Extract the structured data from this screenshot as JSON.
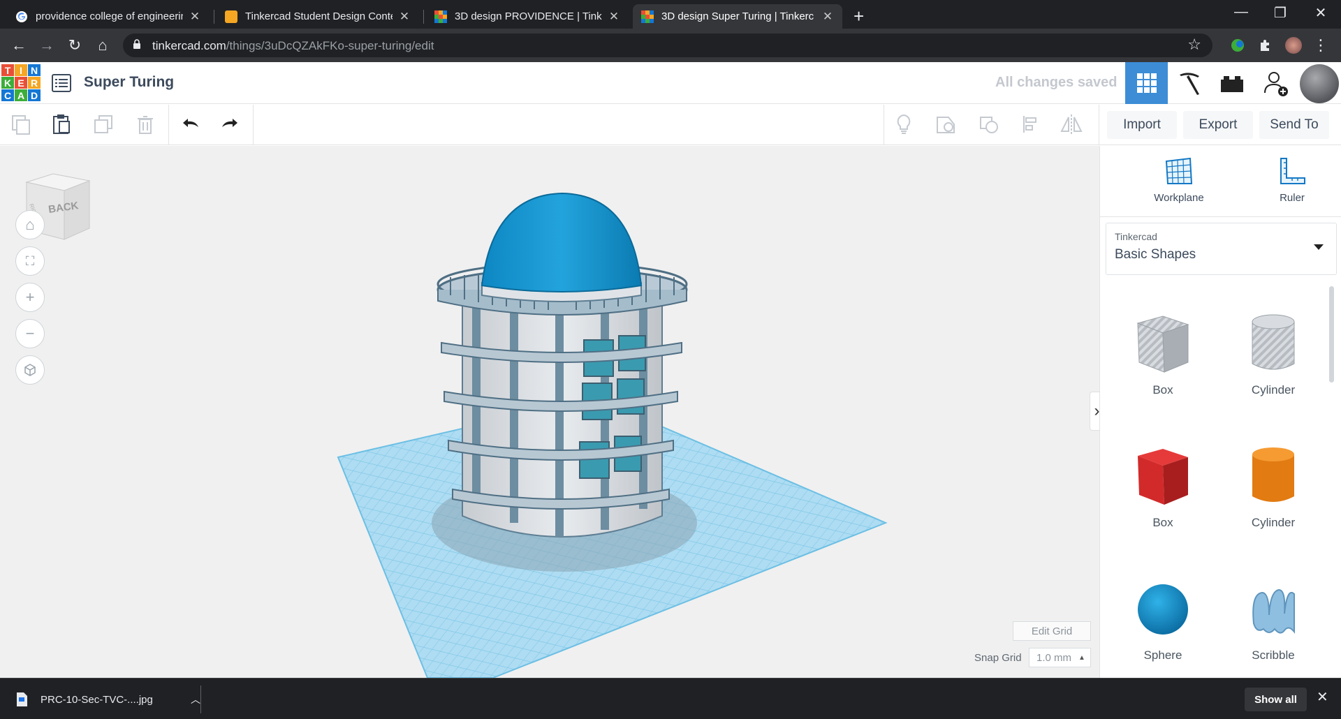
{
  "browser": {
    "tabs": [
      {
        "title": "providence college of engineerin",
        "favicon_color": "#ffffff"
      },
      {
        "title": "Tinkercad Student Design Contes",
        "favicon_color": "#f5a623"
      },
      {
        "title": "3D design PROVIDENCE | Tinkerc",
        "favicon_color": "#e94f37"
      },
      {
        "title": "3D design Super Turing | Tinkerc",
        "favicon_color": "#e94f37"
      }
    ],
    "url_host": "tinkercad.com",
    "url_path": "/things/3uDcQZAkFKo-super-turing/edit"
  },
  "app": {
    "logo_letters": [
      "T",
      "I",
      "N",
      "K",
      "E",
      "R",
      "C",
      "A",
      "D"
    ],
    "logo_colors": [
      "#e94f37",
      "#f5a623",
      "#1477d4",
      "#3cae3a",
      "#e94f37",
      "#f5a623",
      "#1477d4",
      "#3cae3a",
      "#1477d4"
    ],
    "design_title": "Super Turing",
    "save_status": "All changes saved"
  },
  "toolbar": {
    "import_label": "Import",
    "export_label": "Export",
    "send_to_label": "Send To"
  },
  "workplane": {
    "viewcube_label": "BACK",
    "viewcube_side": "RIGHT",
    "edit_grid_label": "Edit Grid",
    "snap_grid_label": "Snap Grid",
    "snap_grid_value": "1.0 mm"
  },
  "panel": {
    "workplane_label": "Workplane",
    "ruler_label": "Ruler",
    "library_category": "Tinkercad",
    "library_value": "Basic Shapes",
    "shapes": [
      {
        "label": "Box"
      },
      {
        "label": "Cylinder"
      },
      {
        "label": "Box"
      },
      {
        "label": "Cylinder"
      },
      {
        "label": "Sphere"
      },
      {
        "label": "Scribble"
      }
    ]
  },
  "downloads": {
    "file_name": "PRC-10-Sec-TVC-....jpg",
    "show_all_label": "Show all"
  }
}
